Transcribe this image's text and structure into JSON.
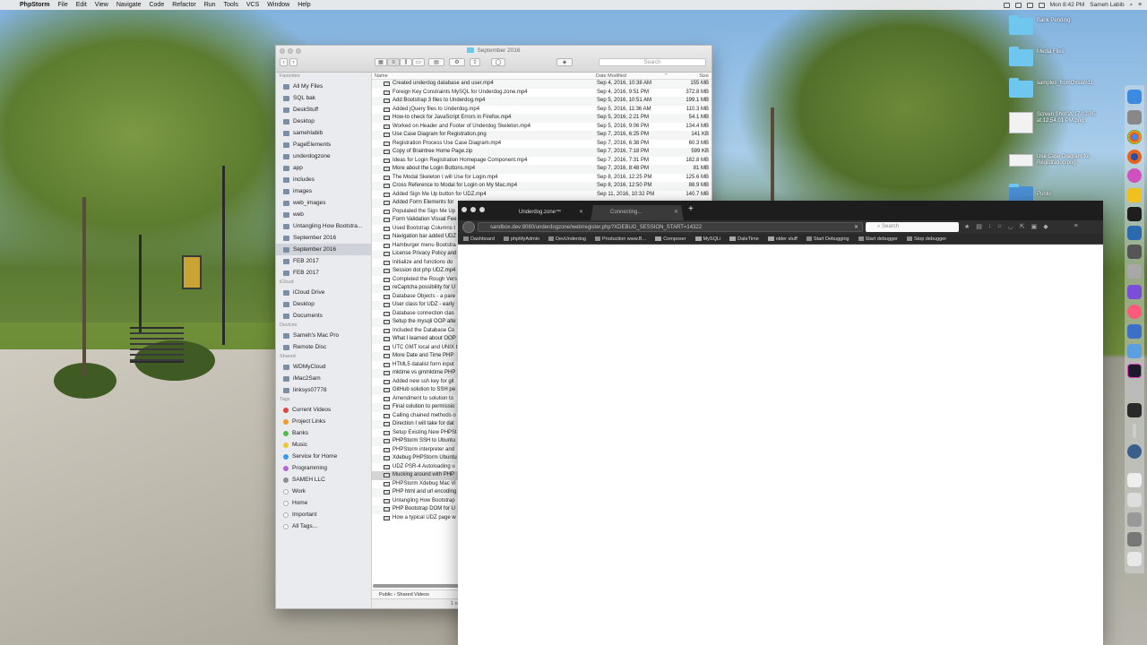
{
  "menubar": {
    "app": "PhpStorm",
    "items": [
      "File",
      "Edit",
      "View",
      "Navigate",
      "Code",
      "Refactor",
      "Run",
      "Tools",
      "VCS",
      "Window",
      "Help"
    ],
    "clock": "Mon 8:42 PM",
    "user": "Sameh Labib"
  },
  "desktop": {
    "icons": [
      "Bank Pending",
      "Media Files",
      "samples_fromOxsam11",
      "Screen Shot 2017-02-05 at 12.54.01 PM.png",
      "Use Case Diagram for Registration.png",
      "Public"
    ]
  },
  "finder": {
    "title": "September 2016",
    "search_placeholder": "Search",
    "sections": {
      "favorites": "Favorites",
      "icloud": "iCloud",
      "devices": "Devices",
      "shared": "Shared",
      "tags": "Tags"
    },
    "favorites": [
      "All My Files",
      "SQL bak",
      "DeskStuff",
      "Desktop",
      "samehlabib",
      "PageElements",
      "underdogzone",
      "app",
      "includes",
      "images",
      "web_images",
      "web",
      "Untangling How Bootstra...",
      "September 2016",
      "September 2016",
      "FEB 2017",
      "FEB 2017"
    ],
    "icloud": [
      "iCloud Drive",
      "Desktop",
      "Documents"
    ],
    "devices": [
      "Sameh's Mac Pro",
      "Remote Disc"
    ],
    "shared": [
      "WDMyCloud",
      "iMac2Sam",
      "linksys07778"
    ],
    "tags": [
      {
        "label": "Current Videos",
        "color": "#e0443e"
      },
      {
        "label": "Project Links",
        "color": "#f39a2b"
      },
      {
        "label": "Banks",
        "color": "#4fbd4a"
      },
      {
        "label": "Music",
        "color": "#f2c82f"
      },
      {
        "label": "Service for Home",
        "color": "#3a9bea"
      },
      {
        "label": "Programming",
        "color": "#b565d6"
      },
      {
        "label": "SAMEH LLC",
        "color": "#8e8e8e"
      },
      {
        "label": "Work",
        "color": "#ffffff"
      },
      {
        "label": "Home",
        "color": "#ffffff"
      },
      {
        "label": "Important",
        "color": "#ffffff"
      },
      {
        "label": "All Tags...",
        "color": "#ffffff"
      }
    ],
    "columns": {
      "name": "Name",
      "date": "Date Modified",
      "size": "Size"
    },
    "rows": [
      {
        "name": "Created underdog database and user.mp4",
        "date": "Sep 4, 2016, 10:38 AM",
        "size": "155 MB"
      },
      {
        "name": "Foreign Key Constraints MySQL for Underdog.zone.mp4",
        "date": "Sep 4, 2016, 9:51 PM",
        "size": "372.8 MB"
      },
      {
        "name": "Add Bootstrap 3 files to Underdog.mp4",
        "date": "Sep 5, 2016, 10:51 AM",
        "size": "199.1 MB"
      },
      {
        "name": "Added jQuery files to Underdog.mp4",
        "date": "Sep 5, 2016, 11:36 AM",
        "size": "110.3 MB"
      },
      {
        "name": "How-to check for JavaScript Errors in Firefox.mp4",
        "date": "Sep 5, 2016, 2:21 PM",
        "size": "54.1 MB"
      },
      {
        "name": "Worked on Header and Footer of Underdog Skeleton.mp4",
        "date": "Sep 5, 2016, 9:06 PM",
        "size": "134.4 MB"
      },
      {
        "name": "Use Case Diagram for Registration.png",
        "date": "Sep 7, 2016, 6:25 PM",
        "size": "141 KB"
      },
      {
        "name": "Registration Process Use Case Diagram.mp4",
        "date": "Sep 7, 2016, 6:38 PM",
        "size": "60.3 MB"
      },
      {
        "name": "Copy of Braintree Home Page.zip",
        "date": "Sep 7, 2016, 7:18 PM",
        "size": "599 KB"
      },
      {
        "name": "Ideas for Login Registration Homepage Component.mp4",
        "date": "Sep 7, 2016, 7:31 PM",
        "size": "182.8 MB"
      },
      {
        "name": "More about the Login Buttons.mp4",
        "date": "Sep 7, 2016, 8:48 PM",
        "size": "81 MB"
      },
      {
        "name": "The Modal Skeleton I will Use for Login.mp4",
        "date": "Sep 8, 2016, 12:25 PM",
        "size": "125.6 MB"
      },
      {
        "name": "Cross Reference to Modal for Login on My Mac.mp4",
        "date": "Sep 8, 2016, 12:50 PM",
        "size": "88.9 MB"
      },
      {
        "name": "Added Sign Me Up button for UDZ.mp4",
        "date": "Sep 11, 2016, 10:32 PM",
        "size": "140.7 MB"
      },
      {
        "name": "Added Form Elements for",
        "date": "",
        "size": ""
      },
      {
        "name": "Populated the Sign Me Up",
        "date": "",
        "size": ""
      },
      {
        "name": "Form Validation Visual Fee",
        "date": "",
        "size": ""
      },
      {
        "name": "Used Bootstrap Columns t",
        "date": "",
        "size": ""
      },
      {
        "name": "Navigation bar added UDZ",
        "date": "",
        "size": ""
      },
      {
        "name": "Hamburger menu Bootstra",
        "date": "",
        "size": ""
      },
      {
        "name": "License Privacy Policy and",
        "date": "",
        "size": ""
      },
      {
        "name": "Initialize and functions do",
        "date": "",
        "size": ""
      },
      {
        "name": "Session dot php UDZ.mp4",
        "date": "",
        "size": ""
      },
      {
        "name": "Completed the Rough Vers",
        "date": "",
        "size": ""
      },
      {
        "name": "reCaptcha possibility for U",
        "date": "",
        "size": ""
      },
      {
        "name": "Database Objects - a pare",
        "date": "",
        "size": ""
      },
      {
        "name": "User class for UDZ - early",
        "date": "",
        "size": ""
      },
      {
        "name": "Database connection clas",
        "date": "",
        "size": ""
      },
      {
        "name": "Setup the mysqli OOP alte",
        "date": "",
        "size": ""
      },
      {
        "name": "Included the Database Co",
        "date": "",
        "size": ""
      },
      {
        "name": "What I learned about OOP",
        "date": "",
        "size": ""
      },
      {
        "name": "UTC GMT local and UNIX t",
        "date": "",
        "size": ""
      },
      {
        "name": "More Date and Time PHP",
        "date": "",
        "size": ""
      },
      {
        "name": "HTML5 datalist form input",
        "date": "",
        "size": ""
      },
      {
        "name": "mktime vs gmmktime PHP",
        "date": "",
        "size": ""
      },
      {
        "name": "Added new ssh key for git",
        "date": "",
        "size": ""
      },
      {
        "name": "GitHub solution to SSH pe",
        "date": "",
        "size": ""
      },
      {
        "name": "Amendment to solution to",
        "date": "",
        "size": ""
      },
      {
        "name": "Final solution to permissio",
        "date": "",
        "size": ""
      },
      {
        "name": "Calling chained methods o",
        "date": "",
        "size": ""
      },
      {
        "name": "Direction I will take for dat",
        "date": "",
        "size": ""
      },
      {
        "name": "Setup Existing New PHPSt",
        "date": "",
        "size": ""
      },
      {
        "name": "PHPStorm SSH to Ubuntu",
        "date": "",
        "size": ""
      },
      {
        "name": "PHPStorm interpreter and",
        "date": "",
        "size": ""
      },
      {
        "name": "Xdebug PHPStorm Ubuntu",
        "date": "",
        "size": ""
      },
      {
        "name": "UDZ PSR-4 Autoloading u",
        "date": "",
        "size": ""
      },
      {
        "name": "Mucking around with PHP",
        "date": "",
        "size": ""
      },
      {
        "name": "PHPStorm Xdebug Mac Vi",
        "date": "",
        "size": ""
      },
      {
        "name": "PHP html and url encoding",
        "date": "",
        "size": ""
      },
      {
        "name": "Untangling How Bootstrap",
        "date": "",
        "size": ""
      },
      {
        "name": "PHP Bootstrap DOM for U",
        "date": "",
        "size": ""
      },
      {
        "name": "How a typical UDZ page w",
        "date": "",
        "size": ""
      }
    ],
    "selected_row": 46,
    "path": [
      "Public",
      "Shared Videos"
    ],
    "status": "1 o"
  },
  "browser": {
    "tabs": [
      {
        "label": "Underdog.zone™"
      },
      {
        "label": "Connecting..."
      }
    ],
    "url": "sandbox.dev:8080/underdogzone/web/register.php?XDEBUG_SESSION_START=14322",
    "search_placeholder": "Search",
    "bookmarks": [
      {
        "label": "Dashboard",
        "kind": "page"
      },
      {
        "label": "phpMyAdmin",
        "kind": "page"
      },
      {
        "label": "DevUnderdog",
        "kind": "page"
      },
      {
        "label": "Production www.B...",
        "kind": "page"
      },
      {
        "label": "Composer",
        "kind": "folder"
      },
      {
        "label": "MySQLi",
        "kind": "folder"
      },
      {
        "label": "DateTime",
        "kind": "folder"
      },
      {
        "label": "older stuff",
        "kind": "folder"
      },
      {
        "label": "Start Debugging",
        "kind": "page"
      },
      {
        "label": "Start debugger",
        "kind": "page"
      },
      {
        "label": "Stop debugger",
        "kind": "page"
      }
    ]
  },
  "dock": {
    "apps": [
      "finder-icon",
      "chrome-icon",
      "firefox-icon",
      "safari-icon",
      "phpstorm-icon",
      "itunes-icon",
      "terminal-icon",
      "trash-icon"
    ]
  }
}
